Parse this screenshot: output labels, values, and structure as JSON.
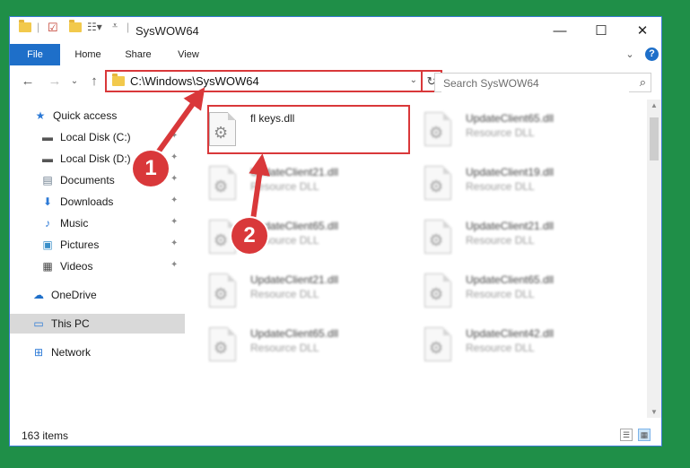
{
  "window": {
    "title": "SysWOW64",
    "minimize_glyph": "—",
    "maximize_glyph": "☐",
    "close_glyph": "✕"
  },
  "quick_access_toolbar": [
    "folder-icon",
    "properties-icon",
    "new-folder-icon",
    "customize-icon"
  ],
  "ribbon": {
    "tabs": [
      "File",
      "Home",
      "Share",
      "View"
    ],
    "expand_glyph": "⌄",
    "help_glyph": "?"
  },
  "nav": {
    "back_glyph": "←",
    "forward_glyph": "→",
    "recent_glyph": "⌄",
    "up_glyph": "↑"
  },
  "address": {
    "path": "C:\\Windows\\SysWOW64",
    "dropdown_glyph": "⌄",
    "refresh_glyph": "↻"
  },
  "search": {
    "placeholder": "Search SysWOW64",
    "icon_glyph": "⌕"
  },
  "sidebar": {
    "items": [
      {
        "label": "Quick access",
        "icon": "star-icon"
      },
      {
        "label": "Local Disk (C:)",
        "icon": "drive-icon",
        "pinned": true
      },
      {
        "label": "Local Disk (D:)",
        "icon": "drive-icon",
        "pinned": true
      },
      {
        "label": "Documents",
        "icon": "documents-icon",
        "pinned": true
      },
      {
        "label": "Downloads",
        "icon": "download-icon",
        "pinned": true
      },
      {
        "label": "Music",
        "icon": "music-icon",
        "pinned": true
      },
      {
        "label": "Pictures",
        "icon": "pictures-icon",
        "pinned": true
      },
      {
        "label": "Videos",
        "icon": "videos-icon",
        "pinned": true
      },
      {
        "label": "OneDrive",
        "icon": "cloud-icon"
      },
      {
        "label": "This PC",
        "icon": "computer-icon",
        "selected": true
      },
      {
        "label": "Network",
        "icon": "network-icon"
      }
    ],
    "pin_glyph": "📌"
  },
  "files": [
    {
      "name": "fl keys.dll",
      "type": ""
    },
    {
      "name": "UpdateClient65.dll",
      "type": "Resource DLL"
    },
    {
      "name": "UpdateClient21.dll",
      "type": "Resource DLL"
    },
    {
      "name": "UpdateClient19.dll",
      "type": "Resource DLL"
    },
    {
      "name": "UpdateClient65.dll",
      "type": "Resource DLL"
    },
    {
      "name": "UpdateClient21.dll",
      "type": "Resource DLL"
    },
    {
      "name": "UpdateClient21.dll",
      "type": "Resource DLL"
    },
    {
      "name": "UpdateClient65.dll",
      "type": "Resource DLL"
    },
    {
      "name": "UpdateClient65.dll",
      "type": "Resource DLL"
    },
    {
      "name": "UpdateClient42.dll",
      "type": "Resource DLL"
    }
  ],
  "status": {
    "item_count": "163 items"
  },
  "annotations": {
    "step1": "1",
    "step2": "2",
    "highlight_color": "#d9383a"
  }
}
